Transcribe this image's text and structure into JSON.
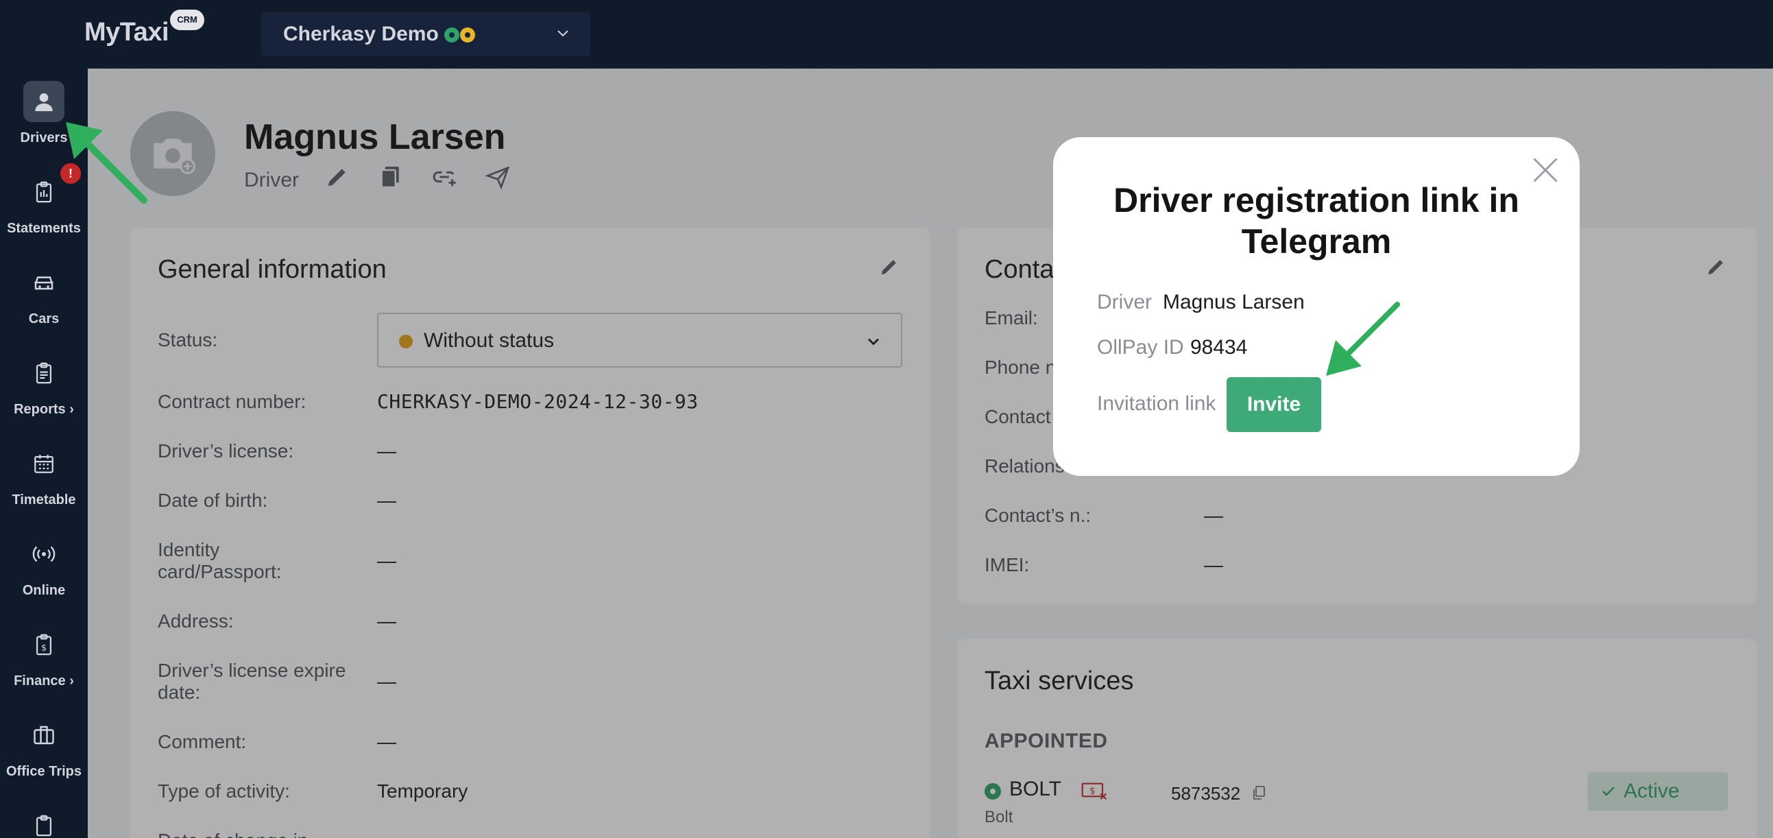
{
  "app": {
    "logo": "MyTaxi",
    "logo_badge": "CRM",
    "company": "Cherkasy Demo"
  },
  "sidebar": {
    "items": [
      {
        "label": "Drivers",
        "icon": "user-icon"
      },
      {
        "label": "Statements",
        "icon": "clipboard-icon",
        "badge": "!"
      },
      {
        "label": "Cars",
        "icon": "car-icon"
      },
      {
        "label": "Reports ›",
        "icon": "report-icon"
      },
      {
        "label": "Timetable",
        "icon": "calendar-icon"
      },
      {
        "label": "Online",
        "icon": "broadcast-icon"
      },
      {
        "label": "Finance ›",
        "icon": "finance-icon"
      },
      {
        "label": "Office Trips",
        "icon": "briefcase-icon"
      }
    ]
  },
  "driver": {
    "name": "Magnus Larsen",
    "role": "Driver"
  },
  "general": {
    "title": "General information",
    "status_label": "Status:",
    "status_value": "Without status",
    "rows": [
      {
        "label": "Contract number:",
        "value": "CHERKASY-DEMO-2024-12-30-93"
      },
      {
        "label": "Driver’s license:",
        "value": "—"
      },
      {
        "label": "Date of birth:",
        "value": "—"
      },
      {
        "label": "Identity card/Passport:",
        "value": "—"
      },
      {
        "label": "Address:",
        "value": "—"
      },
      {
        "label": "Driver’s license expire date:",
        "value": "—"
      },
      {
        "label": "Comment:",
        "value": "—"
      },
      {
        "label": "Type of activity:",
        "value": "Temporary"
      },
      {
        "label": "Date of change in",
        "value": ""
      }
    ]
  },
  "contacts": {
    "title": "Conta",
    "rows": [
      {
        "label": "Email:",
        "value": ""
      },
      {
        "label": "Phone n",
        "value": ""
      },
      {
        "label": "Contact",
        "value": ""
      },
      {
        "label": "Relations",
        "value": ""
      },
      {
        "label": "Contact’s n.:",
        "value": "—"
      },
      {
        "label": "IMEI:",
        "value": "—"
      }
    ]
  },
  "taxi": {
    "title": "Taxi services",
    "subhead": "APPOINTED",
    "service_name": "BOLT",
    "service_sub": "Bolt",
    "service_id": "5873532",
    "service_status": "Active"
  },
  "modal": {
    "title": "Driver registration link in Telegram",
    "driver_label": "Driver",
    "driver_value": "Magnus Larsen",
    "ollpay_label": "OllPay ID",
    "ollpay_value": "98434",
    "invitation_label": "Invitation link",
    "invite_button": "Invite"
  },
  "colors": {
    "sidebar_bg": "#0f1a2b",
    "accent_green": "#3daa78",
    "arrow_green": "#2fae5c",
    "status_dot": "#e8a31a"
  }
}
